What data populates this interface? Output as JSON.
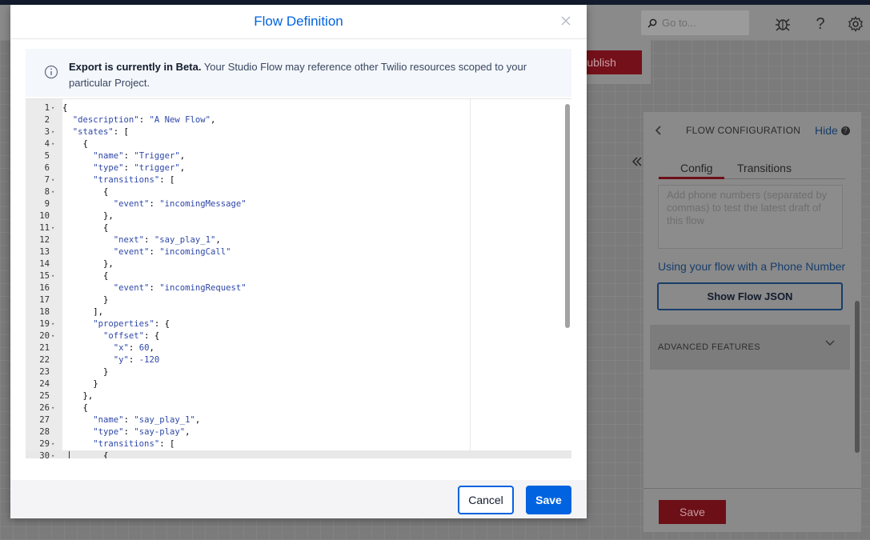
{
  "header": {
    "search_placeholder": "Go to...",
    "icons": [
      "search-icon",
      "bug-icon",
      "help-icon",
      "gear-icon"
    ]
  },
  "toolbar": {
    "publish_label": "Publish"
  },
  "panel": {
    "title": "FLOW CONFIGURATION",
    "hide_label": "Hide",
    "tabs": [
      "Config",
      "Transitions"
    ],
    "active_tab": "Config",
    "phone_placeholder": "Add phone numbers (separated by commas) to test the latest draft of this flow",
    "phone_link": "Using your flow with a Phone Number",
    "show_json_label": "Show Flow JSON",
    "advanced_label": "ADVANCED FEATURES",
    "save_label": "Save"
  },
  "modal": {
    "title": "Flow Definition",
    "info_bold": "Export is currently in Beta.",
    "info_text": " Your Studio Flow may reference other Twilio resources scoped to your particular Project.",
    "cancel_label": "Cancel",
    "save_label": "Save"
  },
  "editor": {
    "lines": [
      {
        "n": "1",
        "fold": true,
        "text": "{"
      },
      {
        "n": "2",
        "fold": false,
        "text": "  \"description\": \"A New Flow\","
      },
      {
        "n": "3",
        "fold": true,
        "text": "  \"states\": ["
      },
      {
        "n": "4",
        "fold": true,
        "text": "    {"
      },
      {
        "n": "5",
        "fold": false,
        "text": "      \"name\": \"Trigger\","
      },
      {
        "n": "6",
        "fold": false,
        "text": "      \"type\": \"trigger\","
      },
      {
        "n": "7",
        "fold": true,
        "text": "      \"transitions\": ["
      },
      {
        "n": "8",
        "fold": true,
        "text": "        {"
      },
      {
        "n": "9",
        "fold": false,
        "text": "          \"event\": \"incomingMessage\""
      },
      {
        "n": "10",
        "fold": false,
        "text": "        },"
      },
      {
        "n": "11",
        "fold": true,
        "text": "        {"
      },
      {
        "n": "12",
        "fold": false,
        "text": "          \"next\": \"say_play_1\","
      },
      {
        "n": "13",
        "fold": false,
        "text": "          \"event\": \"incomingCall\""
      },
      {
        "n": "14",
        "fold": false,
        "text": "        },"
      },
      {
        "n": "15",
        "fold": true,
        "text": "        {"
      },
      {
        "n": "16",
        "fold": false,
        "text": "          \"event\": \"incomingRequest\""
      },
      {
        "n": "17",
        "fold": false,
        "text": "        }"
      },
      {
        "n": "18",
        "fold": false,
        "text": "      ],"
      },
      {
        "n": "19",
        "fold": true,
        "text": "      \"properties\": {"
      },
      {
        "n": "20",
        "fold": true,
        "text": "        \"offset\": {"
      },
      {
        "n": "21",
        "fold": false,
        "text": "          \"x\": 60,"
      },
      {
        "n": "22",
        "fold": false,
        "text": "          \"y\": -120"
      },
      {
        "n": "23",
        "fold": false,
        "text": "        }"
      },
      {
        "n": "24",
        "fold": false,
        "text": "      }"
      },
      {
        "n": "25",
        "fold": false,
        "text": "    },"
      },
      {
        "n": "26",
        "fold": true,
        "text": "    {"
      },
      {
        "n": "27",
        "fold": false,
        "text": "      \"name\": \"say_play_1\","
      },
      {
        "n": "28",
        "fold": false,
        "text": "      \"type\": \"say-play\","
      },
      {
        "n": "29",
        "fold": true,
        "text": "      \"transitions\": ["
      },
      {
        "n": "30",
        "fold": true,
        "text": "        {"
      }
    ]
  },
  "colors": {
    "brand_blue": "#0263e0",
    "publish_red": "#d0021b",
    "code_blue": "#2f48a8"
  }
}
